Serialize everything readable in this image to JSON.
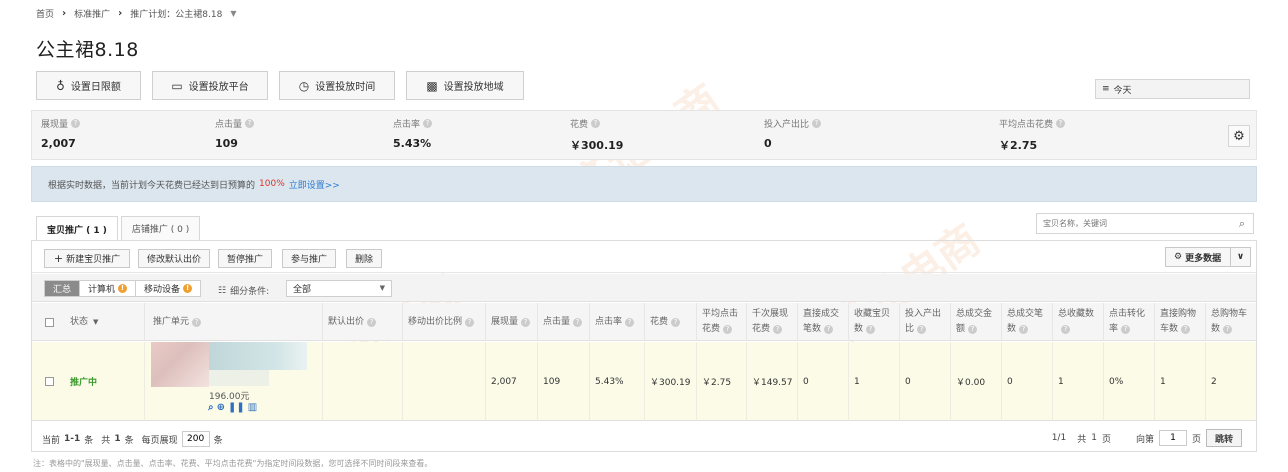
{
  "breadcrumb": {
    "home": "首页",
    "sep1": "›",
    "level2": "标准推广",
    "sep2": "›",
    "current": "推广计划：公主裙8.18"
  },
  "page_title": "公主裙8.18",
  "toolbar": {
    "daily_budget": "设置日限额",
    "platform": "设置投放平台",
    "time": "设置投放时间",
    "region": "设置投放地域",
    "date_range": "今天"
  },
  "metrics": [
    {
      "label": "展现量",
      "value": "2,007"
    },
    {
      "label": "点击量",
      "value": "109"
    },
    {
      "label": "点击率",
      "value": "5.43%"
    },
    {
      "label": "花费",
      "value": "￥300.19"
    },
    {
      "label": "投入产出比",
      "value": "0"
    },
    {
      "label": "平均点击花费",
      "value": "￥2.75"
    }
  ],
  "notice": {
    "text": "根据实时数据，当前计划今天花费已经达到日预算的",
    "percent": "100%",
    "link": "立即设置>>"
  },
  "tabs": [
    {
      "label": "宝贝推广 ( 1 )"
    },
    {
      "label": "店铺推广 ( 0 )"
    }
  ],
  "search": {
    "placeholder": "宝贝名称，关键词"
  },
  "actions": {
    "new_item": "新建宝贝推广",
    "edit_bid": "修改默认出价",
    "pause": "暂停推广",
    "join": "参与推广",
    "delete": "删除",
    "more_data": "更多数据"
  },
  "filter": {
    "summary": "汇总",
    "computer": "计算机",
    "mobile": "移动设备",
    "condition_label": "细分条件:",
    "condition_value": "全部"
  },
  "columns": {
    "status": "状态",
    "unit": "推广单元",
    "default_bid": "默认出价",
    "mobile_ratio": "移动出价比例",
    "impressions": "展现量",
    "clicks": "点击量",
    "ctr": "点击率",
    "cost": "花费",
    "avg_cpc_1": "平均点击",
    "avg_cpc_2": "花费",
    "cpm_1": "千次展现",
    "cpm_2": "花费",
    "direct_orders_1": "直接成交",
    "direct_orders_2": "笔数",
    "fav_items_1": "收藏宝贝",
    "fav_items_2": "数",
    "roi_1": "投入产出",
    "roi_2": "比",
    "total_gmv_1": "总成交金",
    "total_gmv_2": "额",
    "total_orders_1": "总成交笔",
    "total_orders_2": "数",
    "total_fav": "总收藏数",
    "conv_1": "点击转化",
    "conv_2": "率",
    "direct_cart_1": "直接购物",
    "direct_cart_2": "车数",
    "total_cart_1": "总购物车",
    "total_cart_2": "数"
  },
  "row": {
    "status": "推广中",
    "price": "196.00元",
    "impressions": "2,007",
    "clicks": "109",
    "ctr": "5.43%",
    "cost": "￥300.19",
    "avg_cpc": "￥2.75",
    "cpm": "￥149.57",
    "direct_orders": "0",
    "fav_items": "1",
    "roi": "0",
    "total_gmv": "￥0.00",
    "total_orders": "0",
    "total_fav": "1",
    "conv": "0%",
    "direct_cart": "1",
    "total_cart": "2"
  },
  "pager": {
    "current_label": "当前",
    "range": "1-1",
    "items_label": "条",
    "total_prefix": "共",
    "total": "1",
    "total_suffix": "条",
    "per_page_label": "每页展现",
    "per_page": "200",
    "per_page_suffix": "条",
    "page_info": "1/1",
    "pages_prefix": "共",
    "pages": "1",
    "pages_suffix": "页",
    "goto_prefix": "向第",
    "goto_value": "1",
    "goto_suffix": "页",
    "goto_button": "跳转"
  },
  "footnote": "注：表格中的\"展现量、点击量、点击率、花费、平均点击花费\"为指定时间段数据，您可选择不同时间段来查看。",
  "watermark": "齐论电商",
  "colors": {
    "active_status": "#3c9a2c",
    "link": "#2f7bd0",
    "alert": "#d9362b",
    "notice_bg": "#dbe6ee",
    "row_highlight": "#fbfbe8"
  }
}
